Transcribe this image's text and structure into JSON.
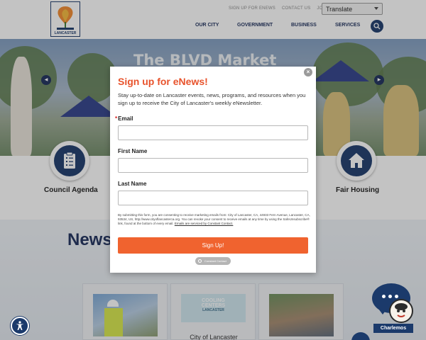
{
  "header": {
    "logo_text": "LANCASTER",
    "utility_links": [
      "SIGN UP FOR ENEWS",
      "CONTACT US",
      "JOBS"
    ],
    "translate_label": "Translate",
    "nav": [
      "OUR CITY",
      "GOVERNMENT",
      "BUSINESS",
      "SERVICES"
    ]
  },
  "hero": {
    "title": "The BLVD Market"
  },
  "quick_links": [
    {
      "label": "Council Agenda",
      "icon": "clipboard-icon"
    },
    {
      "label": "Fair Housing",
      "icon": "house-icon"
    }
  ],
  "news": {
    "heading": "News",
    "cards": [
      {
        "image": "worker-photo",
        "title": ""
      },
      {
        "image": "cooling-centers-graphic",
        "image_text_top": "COOLING",
        "image_text_mid": "CENTERS",
        "image_text_bot": "LANCASTER",
        "title": "City of Lancaster"
      },
      {
        "image": "crowd-photo",
        "title": ""
      }
    ]
  },
  "modal": {
    "title": "Sign up for eNews!",
    "description": "Stay up-to-date on Lancaster events, news, programs, and resources when you sign up to receive the City of Lancaster's weekly eNewsletter.",
    "required_mark": "*",
    "email_label": "Email",
    "email_value": "",
    "first_name_label": "First Name",
    "first_name_value": "",
    "last_name_label": "Last Name",
    "last_name_value": "",
    "consent_text": "By submitting this form, you are consenting to receive marketing emails from: City of Lancaster, CA, 44933 Fern Avenue, Lancaster, CA, 93534, US, http://www.cityoflancasterca.org. You can revoke your consent to receive emails at any time by using the SafeUnsubscribe® link, found at the bottom of every email.",
    "consent_link": "Emails are serviced by Constant Contact.",
    "signup_label": "Sign Up!",
    "cc_badge": "Constant Contact",
    "close_symbol": "×"
  },
  "chat": {
    "label": "Charlemos"
  },
  "colors": {
    "navy": "#1b3a6b",
    "accent_orange": "#f0632f",
    "title_orange": "#e8532c"
  }
}
